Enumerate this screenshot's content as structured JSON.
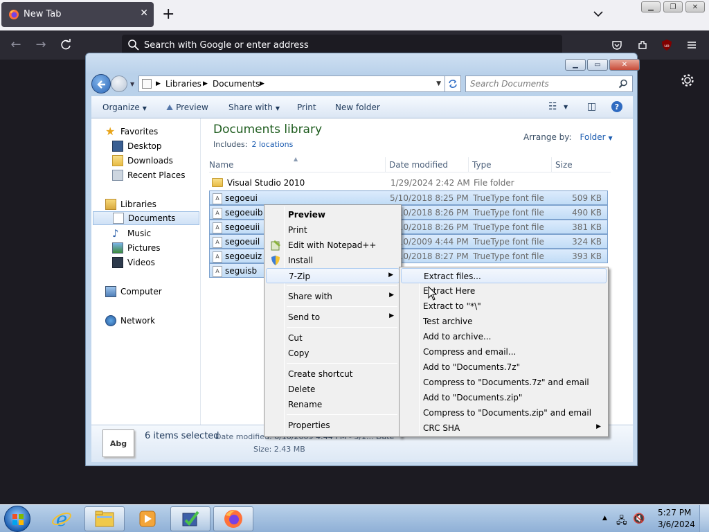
{
  "firefox": {
    "tab_title": "New Tab",
    "search_placeholder": "Search with Google or enter address"
  },
  "explorer": {
    "breadcrumb": [
      "Libraries",
      "Documents"
    ],
    "search_placeholder": "Search Documents",
    "toolbar": {
      "organize": "Organize",
      "preview": "Preview",
      "share_with": "Share with",
      "print": "Print",
      "new_folder": "New folder"
    },
    "nav": {
      "favorites": "Favorites",
      "desktop": "Desktop",
      "downloads": "Downloads",
      "recent_places": "Recent Places",
      "libraries": "Libraries",
      "documents": "Documents",
      "music": "Music",
      "pictures": "Pictures",
      "videos": "Videos",
      "computer": "Computer",
      "network": "Network"
    },
    "library_title": "Documents library",
    "includes_label": "Includes:",
    "includes_link": "2 locations",
    "arrange_label": "Arrange by:",
    "arrange_value": "Folder",
    "columns": {
      "name": "Name",
      "date": "Date modified",
      "type": "Type",
      "size": "Size"
    },
    "files": [
      {
        "name": "Visual Studio 2010",
        "date": "1/29/2024 2:42 AM",
        "type": "File folder",
        "size": ""
      },
      {
        "name": "segoeui",
        "date": "5/10/2018 8:25 PM",
        "type": "TrueType font file",
        "size": "509 KB"
      },
      {
        "name": "segoeuib",
        "date": "5/10/2018 8:26 PM",
        "type": "TrueType font file",
        "size": "490 KB"
      },
      {
        "name": "segoeuii",
        "date": "5/10/2018 8:26 PM",
        "type": "TrueType font file",
        "size": "381 KB"
      },
      {
        "name": "segoeuil",
        "date": "6/10/2009 4:44 PM",
        "type": "TrueType font file",
        "size": "324 KB"
      },
      {
        "name": "segoeuiz",
        "date": "5/10/2018 8:27 PM",
        "type": "TrueType font file",
        "size": "393 KB"
      },
      {
        "name": "seguisb",
        "date": "",
        "type": "",
        "size": ""
      }
    ],
    "details": {
      "thumb_text": "Abg",
      "count": "6 items selected",
      "date_line": "Date modified: 6/10/2009 4:44 PM - 5/1... Date cre...",
      "size_line": "Size: 2.43 MB"
    }
  },
  "context_menu": {
    "preview": "Preview",
    "print": "Print",
    "edit_notepad": "Edit with Notepad++",
    "install": "Install",
    "seven_zip": "7-Zip",
    "share_with": "Share with",
    "send_to": "Send to",
    "cut": "Cut",
    "copy": "Copy",
    "create_shortcut": "Create shortcut",
    "delete": "Delete",
    "rename": "Rename",
    "properties": "Properties"
  },
  "zip_menu": {
    "items": [
      "Extract files...",
      "Extract Here",
      "Extract to \"*\\\"",
      "Test archive",
      "Add to archive...",
      "Compress and email...",
      "Add to \"Documents.7z\"",
      "Compress to \"Documents.7z\" and email",
      "Add to \"Documents.zip\"",
      "Compress to \"Documents.zip\" and email",
      "CRC SHA"
    ]
  },
  "taskbar": {
    "time": "5:27 PM",
    "date": "3/6/2024"
  }
}
